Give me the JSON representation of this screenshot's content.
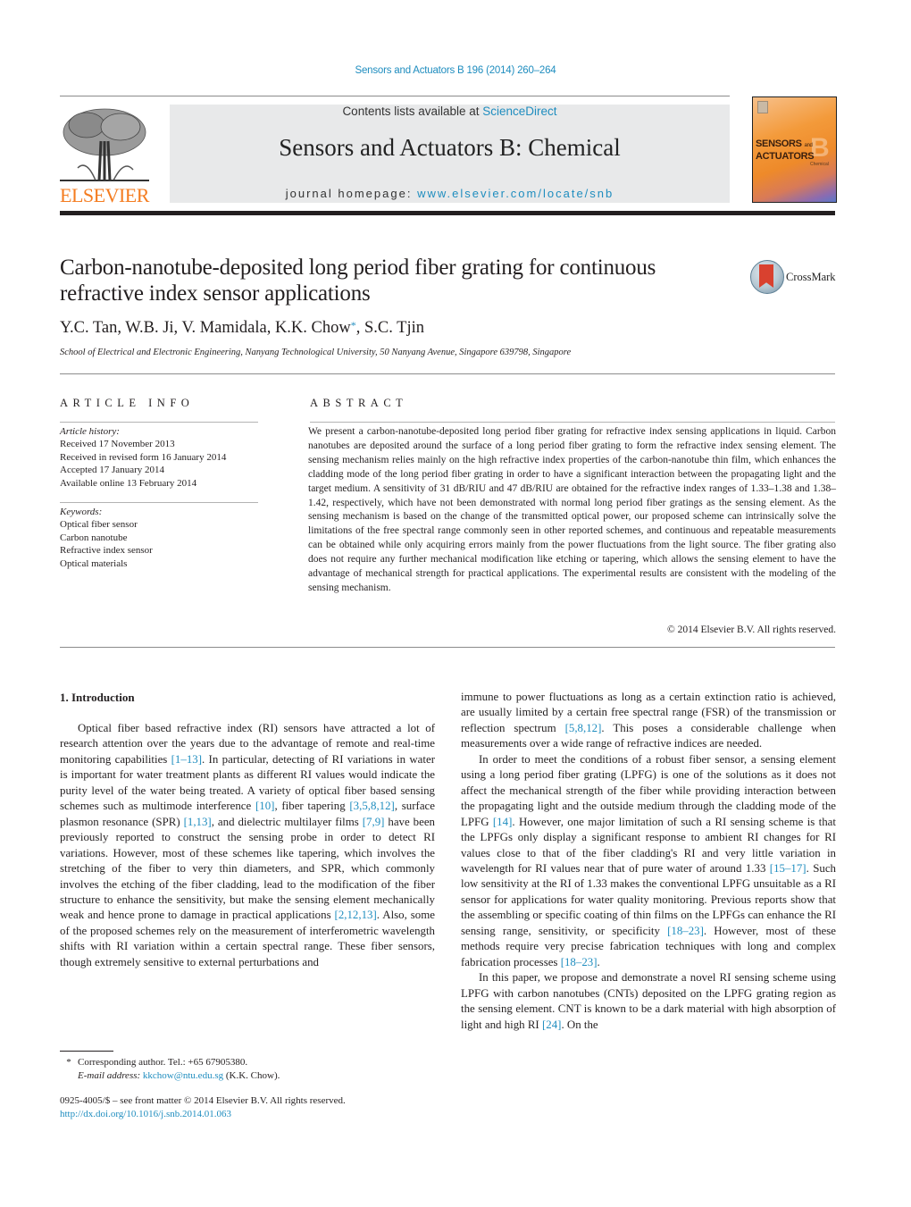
{
  "header": {
    "citation": "Sensors and Actuators B 196 (2014) 260–264",
    "contents_prefix": "Contents lists available at ",
    "contents_link": "ScienceDirect",
    "journal_title": "Sensors and Actuators B: Chemical",
    "homepage_prefix": "journal homepage: ",
    "homepage_link": "www.elsevier.com/locate/snb",
    "publisher_logo_text": "ELSEVIER",
    "cover": {
      "line1": "SENSORS",
      "and": "and",
      "line2": "ACTUATORS",
      "letter": "B",
      "subtitle": "Chemical"
    },
    "colors": {
      "link": "#1f8dbf",
      "elsevier_orange": "#f47c20",
      "masthead_bg": "#e8e9ea"
    }
  },
  "article": {
    "title": "Carbon-nanotube-deposited long period fiber grating for continuous refractive index sensor applications",
    "crossmark_label": "CrossMark",
    "authors_before": "Y.C. Tan, W.B. Ji, V. Mamidala, K.K. Chow",
    "corresponding_mark": "*",
    "authors_after": ", S.C. Tjin",
    "affiliation": "School of Electrical and Electronic Engineering, Nanyang Technological University, 50 Nanyang Avenue, Singapore 639798, Singapore"
  },
  "article_info": {
    "heading": "ARTICLE INFO",
    "history_label": "Article history:",
    "history": [
      "Received 17 November 2013",
      "Received in revised form 16 January 2014",
      "Accepted 17 January 2014",
      "Available online 13 February 2014"
    ],
    "keywords_label": "Keywords:",
    "keywords": [
      "Optical fiber sensor",
      "Carbon nanotube",
      "Refractive index sensor",
      "Optical materials"
    ]
  },
  "abstract": {
    "heading": "ABSTRACT",
    "text": "We present a carbon-nanotube-deposited long period fiber grating for refractive index sensing applica­tions in liquid. Carbon nanotubes are deposited around the surface of a long period fiber grating to form the refractive index sensing element. The sensing mechanism relies mainly on the high refractive index properties of the carbon-nanotube thin film, which enhances the cladding mode of the long period fiber grating in order to have a significant interaction between the propagating light and the target medium. A sensitivity of 31 dB/RIU and 47 dB/RIU are obtained for the refractive index ranges of 1.33–1.38 and 1.38–1.42, respectively, which have not been demonstrated with normal long period fiber gratings as the sensing element. As the sensing mechanism is based on the change of the transmitted optical power, our proposed scheme can intrinsically solve the limitations of the free spectral range commonly seen in other reported schemes, and continuous and repeatable measurements can be obtained while only acquiring errors mainly from the power fluctuations from the light source. The fiber grating also does not require any further mechanical modification like etching or tapering, which allows the sensing element to have the advantage of mechanical strength for practical applications. The experimental results are consistent with the modeling of the sensing mechanism.",
    "copyright": "© 2014 Elsevier B.V. All rights reserved."
  },
  "body": {
    "section_heading": "1.  Introduction",
    "left_p1": [
      {
        "t": "Optical fiber based refractive index (RI) sensors have attracted a lot of research attention over the years due to the advantage of remote and real-time monitoring capabilities "
      },
      {
        "ref": "[1–13]"
      },
      {
        "t": ". In particular, detecting of RI variations in water is important for water treatment plants as different RI values would indicate the purity level of the water being treated. A variety of optical fiber based sensing schemes such as multimode interference "
      },
      {
        "ref": "[10]"
      },
      {
        "t": ", fiber tapering "
      },
      {
        "ref": "[3,5,8,12]"
      },
      {
        "t": ", surface plasmon resonance (SPR) "
      },
      {
        "ref": "[1,13]"
      },
      {
        "t": ", and dielectric multilayer films "
      },
      {
        "ref": "[7,9]"
      },
      {
        "t": " have been previously reported to construct the sensing probe in order to detect RI variations. However, most of these schemes like tapering, which involves the stretching of the fiber to very thin diameters, and SPR, which commonly involves the etching of the fiber cladding, lead to the modification of the fiber structure to enhance the sensitivity, but make the sensing element mechanically weak and hence prone to damage in practical applications "
      },
      {
        "ref": "[2,12,13]"
      },
      {
        "t": ". Also, some of the proposed schemes rely on the measurement of interferometric wavelength shifts with RI variation within a certain spectral range. These fiber sensors, though extremely sensitive to external perturbations and"
      }
    ],
    "right_p1": [
      {
        "t": "immune to power fluctuations as long as a certain extinction ratio is achieved, are usually limited by a certain free spectral range (FSR) of the transmission or reflection spectrum "
      },
      {
        "ref": "[5,8,12]"
      },
      {
        "t": ". This poses a considerable challenge when measurements over a wide range of refractive indices are needed."
      }
    ],
    "right_p2": [
      {
        "t": "In order to meet the conditions of a robust fiber sensor, a sensing element using a long period fiber grating (LPFG) is one of the solu­tions as it does not affect the mechanical strength of the fiber while providing interaction between the propagating light and the outside medium through the cladding mode of the LPFG "
      },
      {
        "ref": "[14]"
      },
      {
        "t": ". How­ever, one major limitation of such a RI sensing scheme is that the LPFGs only display a significant response to ambient RI changes for RI values close to that of the fiber cladding's RI and very little variation in wavelength for RI values near that of pure water of around 1.33 "
      },
      {
        "ref": "[15–17]"
      },
      {
        "t": ". Such low sensitivity at the RI of 1.33 makes the conventional LPFG unsuitable as a RI sensor for applications for water quality monitoring. Previous reports show that the assem­bling or specific coating of thin films on the LPFGs can enhance the RI sensing range, sensitivity, or specificity "
      },
      {
        "ref": "[18–23]"
      },
      {
        "t": ". However, most of these methods require very precise fabrication techniques with long and complex fabrication processes "
      },
      {
        "ref": "[18–23]"
      },
      {
        "t": "."
      }
    ],
    "right_p3": [
      {
        "t": "In this paper, we propose and demonstrate a novel RI sensing scheme using LPFG with carbon nanotubes (CNTs) deposited on the LPFG grating region as the sensing element. CNT is known to be a dark material with high absorption of light and high RI "
      },
      {
        "ref": "[24]"
      },
      {
        "t": ". On the"
      }
    ]
  },
  "footnote": {
    "star": "*",
    "corresponding": "Corresponding author. Tel.: +65 67905380.",
    "email_label": "E-mail address:",
    "email": "kkchow@ntu.edu.sg",
    "email_suffix": " (K.K. Chow).",
    "frontmatter": "0925-4005/$ – see front matter © 2014 Elsevier B.V. All rights reserved.",
    "doi": "http://dx.doi.org/10.1016/j.snb.2014.01.063"
  }
}
